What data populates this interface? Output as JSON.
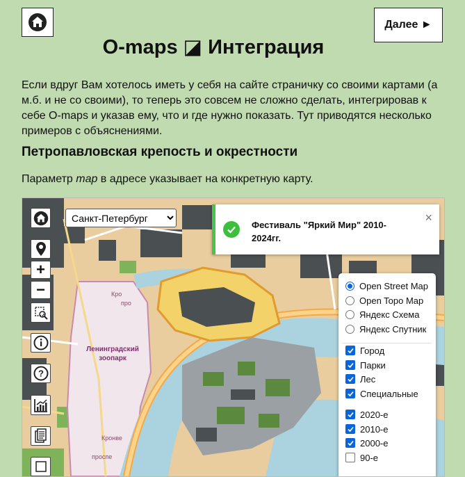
{
  "header": {
    "next_label": "Далее ►",
    "title": "O-maps ◪ Интеграция"
  },
  "intro": "Если вдруг Вам хотелось иметь у себя на сайте страничку со своими картами (а м.б. и не со своими), то теперь это совсем не сложно сделать, интегрировав к себе O-maps и указав ему, что и где нужно показать. Тут приводятся несколько примеров с объяснениями.",
  "section": {
    "title": "Петропавловская крепость и окрестности",
    "text_before": "Параметр ",
    "text_param": "map",
    "text_after": " в адресе указывает на конкретную карту."
  },
  "map": {
    "city_select": {
      "selected": "Санкт-Петербург",
      "options": [
        "Санкт-Петербург"
      ]
    },
    "notification": {
      "text": "Фестиваль \"Яркий Мир\" 2010-2024гг.",
      "close": "×"
    },
    "labels": {
      "zoo": "Ленинградский зоопарк",
      "kron": "Кро",
      "pro": "про",
      "kronv_bottom": "Кронве",
      "prosp_bottom": "проспе"
    },
    "base_layers": [
      {
        "label": "Open Street Map",
        "selected": true
      },
      {
        "label": "Open Topo Map",
        "selected": false
      },
      {
        "label": "Яндекс Схема",
        "selected": false
      },
      {
        "label": "Яндекс Спутник",
        "selected": false
      }
    ],
    "overlays_a": [
      {
        "label": "Город",
        "checked": true
      },
      {
        "label": "Парки",
        "checked": true
      },
      {
        "label": "Лес",
        "checked": true
      },
      {
        "label": "Специальные",
        "checked": true
      }
    ],
    "overlays_b": [
      {
        "label": "2020-е",
        "checked": true
      },
      {
        "label": "2010-е",
        "checked": true
      },
      {
        "label": "2000-е",
        "checked": true
      },
      {
        "label": "90-е",
        "checked": false
      }
    ],
    "controls": {
      "zoom_in": "+",
      "zoom_out": "−",
      "help": "?",
      "info": "i"
    }
  },
  "colors": {
    "page_bg": "#bfdbaf",
    "notify_accent": "#4cc24c",
    "checkbox": "#0a66d8"
  }
}
